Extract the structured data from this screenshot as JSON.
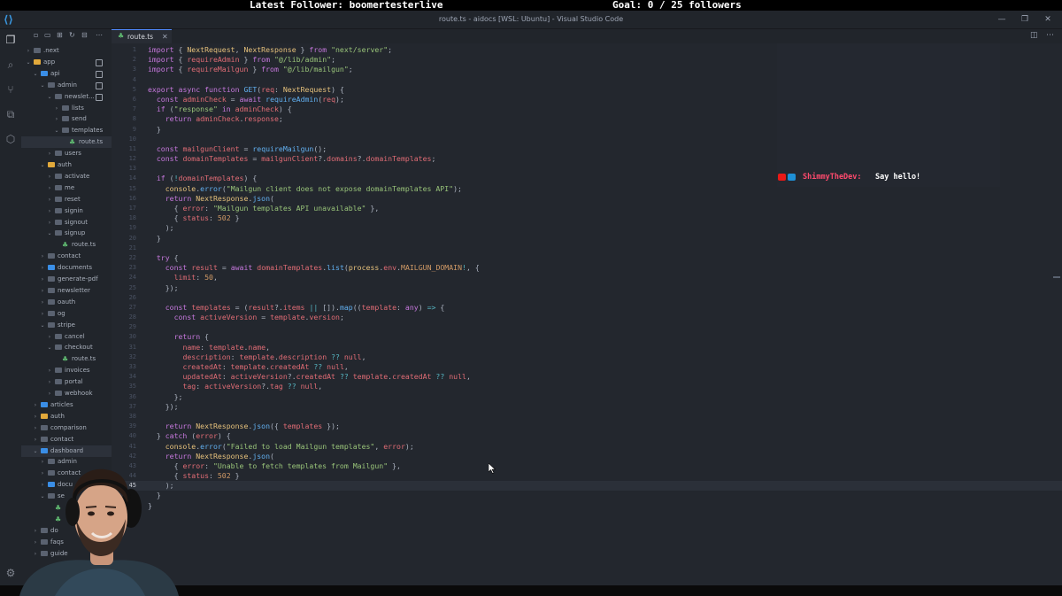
{
  "stream": {
    "latest_follower": "Latest Follower: boomertesterlive",
    "goal": "Goal: 0 / 25 followers"
  },
  "window": {
    "title": "route.ts - aidocs [WSL: Ubuntu] - Visual Studio Code"
  },
  "activity_bar": [
    {
      "name": "explorer-icon",
      "glyph": "❐"
    },
    {
      "name": "search-icon",
      "glyph": "⌕"
    },
    {
      "name": "source-control-icon",
      "glyph": "⑂"
    },
    {
      "name": "remote-explorer-icon",
      "glyph": "⧉"
    },
    {
      "name": "extensions-icon",
      "glyph": "⬡"
    }
  ],
  "explorer": {
    "items": [
      {
        "label": ".next",
        "depth": 0,
        "expanded": false,
        "icon": "folder"
      },
      {
        "label": "app",
        "depth": 0,
        "expanded": true,
        "icon": "special"
      },
      {
        "label": "api",
        "depth": 1,
        "expanded": true,
        "icon": "blue"
      },
      {
        "label": "admin",
        "depth": 2,
        "expanded": true,
        "icon": "folder"
      },
      {
        "label": "newslet...",
        "depth": 3,
        "expanded": true,
        "icon": "folder"
      },
      {
        "label": "lists",
        "depth": 4,
        "expanded": false,
        "icon": "folder"
      },
      {
        "label": "send",
        "depth": 4,
        "expanded": false,
        "icon": "folder"
      },
      {
        "label": "templates",
        "depth": 4,
        "expanded": true,
        "icon": "folder"
      },
      {
        "label": "route.ts",
        "depth": 5,
        "expanded": null,
        "icon": "file",
        "selected": true
      },
      {
        "label": "users",
        "depth": 3,
        "expanded": false,
        "icon": "folder"
      },
      {
        "label": "auth",
        "depth": 2,
        "expanded": true,
        "icon": "special"
      },
      {
        "label": "activate",
        "depth": 3,
        "expanded": false,
        "icon": "folder"
      },
      {
        "label": "me",
        "depth": 3,
        "expanded": false,
        "icon": "folder"
      },
      {
        "label": "reset",
        "depth": 3,
        "expanded": false,
        "icon": "folder"
      },
      {
        "label": "signin",
        "depth": 3,
        "expanded": false,
        "icon": "folder"
      },
      {
        "label": "signout",
        "depth": 3,
        "expanded": false,
        "icon": "folder"
      },
      {
        "label": "signup",
        "depth": 3,
        "expanded": true,
        "icon": "folder"
      },
      {
        "label": "route.ts",
        "depth": 4,
        "expanded": null,
        "icon": "file"
      },
      {
        "label": "contact",
        "depth": 2,
        "expanded": false,
        "icon": "folder"
      },
      {
        "label": "documents",
        "depth": 2,
        "expanded": false,
        "icon": "blue"
      },
      {
        "label": "generate-pdf",
        "depth": 2,
        "expanded": false,
        "icon": "folder"
      },
      {
        "label": "newsletter",
        "depth": 2,
        "expanded": false,
        "icon": "folder"
      },
      {
        "label": "oauth",
        "depth": 2,
        "expanded": false,
        "icon": "folder"
      },
      {
        "label": "og",
        "depth": 2,
        "expanded": false,
        "icon": "folder"
      },
      {
        "label": "stripe",
        "depth": 2,
        "expanded": true,
        "icon": "folder"
      },
      {
        "label": "cancel",
        "depth": 3,
        "expanded": false,
        "icon": "folder"
      },
      {
        "label": "checkout",
        "depth": 3,
        "expanded": true,
        "icon": "folder"
      },
      {
        "label": "route.ts",
        "depth": 4,
        "expanded": null,
        "icon": "file"
      },
      {
        "label": "invoices",
        "depth": 3,
        "expanded": false,
        "icon": "folder"
      },
      {
        "label": "portal",
        "depth": 3,
        "expanded": false,
        "icon": "folder"
      },
      {
        "label": "webhook",
        "depth": 3,
        "expanded": false,
        "icon": "folder"
      },
      {
        "label": "articles",
        "depth": 1,
        "expanded": false,
        "icon": "blue"
      },
      {
        "label": "auth",
        "depth": 1,
        "expanded": false,
        "icon": "special"
      },
      {
        "label": "comparison",
        "depth": 1,
        "expanded": false,
        "icon": "folder"
      },
      {
        "label": "contact",
        "depth": 1,
        "expanded": false,
        "icon": "folder"
      },
      {
        "label": "dashboard",
        "depth": 1,
        "expanded": true,
        "icon": "blue",
        "selected": true
      },
      {
        "label": "admin",
        "depth": 2,
        "expanded": false,
        "icon": "folder"
      },
      {
        "label": "contact",
        "depth": 2,
        "expanded": false,
        "icon": "folder"
      },
      {
        "label": "docu",
        "depth": 2,
        "expanded": false,
        "icon": "blue"
      },
      {
        "label": "se",
        "depth": 2,
        "expanded": true,
        "icon": "folder"
      },
      {
        "label": "",
        "depth": 3,
        "expanded": null,
        "icon": "file"
      },
      {
        "label": "",
        "depth": 3,
        "expanded": null,
        "icon": "file"
      },
      {
        "label": "do",
        "depth": 1,
        "expanded": false,
        "icon": "folder"
      },
      {
        "label": "faqs",
        "depth": 1,
        "expanded": false,
        "icon": "folder"
      },
      {
        "label": "guide",
        "depth": 1,
        "expanded": false,
        "icon": "folder"
      }
    ]
  },
  "tabs": [
    {
      "label": "route.ts",
      "active": true
    }
  ],
  "editor": {
    "current_line": 45,
    "lines": [
      "import { NextRequest, NextResponse } from \"next/server\";",
      "import { requireAdmin } from \"@/lib/admin\";",
      "import { requireMailgun } from \"@/lib/mailgun\";",
      "",
      "export async function GET(req: NextRequest) {",
      "  const adminCheck = await requireAdmin(req);",
      "  if (\"response\" in adminCheck) {",
      "    return adminCheck.response;",
      "  }",
      "",
      "  const mailgunClient = requireMailgun();",
      "  const domainTemplates = mailgunClient?.domains?.domainTemplates;",
      "",
      "  if (!domainTemplates) {",
      "    console.error(\"Mailgun client does not expose domainTemplates API\");",
      "    return NextResponse.json(",
      "      { error: \"Mailgun templates API unavailable\" },",
      "      { status: 502 }",
      "    );",
      "  }",
      "",
      "  try {",
      "    const result = await domainTemplates.list(process.env.MAILGUN_DOMAIN!, {",
      "      limit: 50,",
      "    });",
      "",
      "    const templates = (result?.items || []).map((template: any) => {",
      "      const activeVersion = template.version;",
      "",
      "      return {",
      "        name: template.name,",
      "        description: template.description ?? null,",
      "        createdAt: template.createdAt ?? null,",
      "        updatedAt: activeVersion?.createdAt ?? template.createdAt ?? null,",
      "        tag: activeVersion?.tag ?? null,",
      "      };",
      "    });",
      "",
      "    return NextResponse.json({ templates });",
      "  } catch (error) {",
      "    console.error(\"Failed to load Mailgun templates\", error);",
      "    return NextResponse.json(",
      "      { error: \"Unable to fetch templates from Mailgun\" },",
      "      { status: 502 }",
      "    );",
      "  }",
      "}"
    ]
  },
  "chat": {
    "username": "ShimmyTheDev:",
    "message": "Say hello!"
  },
  "colors": {
    "accent": "#528bff",
    "editor_bg": "#23272e",
    "sidebar_bg": "#21252b"
  }
}
